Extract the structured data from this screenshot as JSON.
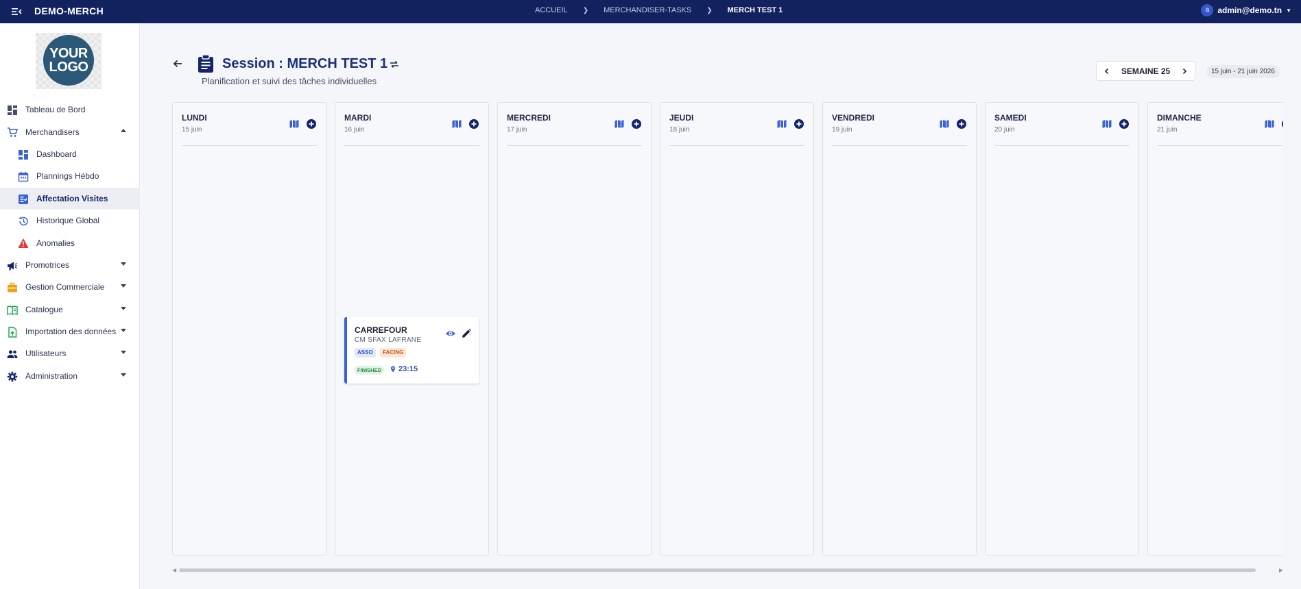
{
  "app": {
    "title": "DEMO-MERCH"
  },
  "breadcrumb": [
    "ACCUEIL",
    "MERCHANDISER-TASKS",
    "MERCH TEST 1"
  ],
  "user": {
    "initial": "a",
    "email": "admin@demo.tn"
  },
  "logo": {
    "line1": "YOUR",
    "line2": "LOGO"
  },
  "sidebar": {
    "items": [
      {
        "label": "Tableau de Bord",
        "icon": "dashboard-icon"
      },
      {
        "label": "Merchandisers",
        "icon": "cart-icon",
        "expanded": true
      },
      {
        "label": "Dashboard",
        "icon": "dashboard-grid-icon"
      },
      {
        "label": "Plannings Hébdo",
        "icon": "calendar-icon"
      },
      {
        "label": "Affectation Visites",
        "icon": "checklist-icon",
        "active": true
      },
      {
        "label": "Historique Global",
        "icon": "history-icon"
      },
      {
        "label": "Anomalies",
        "icon": "warning-icon"
      },
      {
        "label": "Promotrices",
        "icon": "megaphone-icon"
      },
      {
        "label": "Gestion Commerciale",
        "icon": "briefcase-icon"
      },
      {
        "label": "Catalogue",
        "icon": "book-icon"
      },
      {
        "label": "Importation des données",
        "icon": "upload-file-icon"
      },
      {
        "label": "Utilisateurs",
        "icon": "users-icon"
      },
      {
        "label": "Administration",
        "icon": "gear-icon"
      }
    ]
  },
  "header": {
    "title": "Session : MERCH TEST 1",
    "subtitle": "Planification et suivi des tâches individuelles",
    "week_label": "SEMAINE 25",
    "date_range": "15 juin - 21 juin 2026"
  },
  "days": [
    {
      "name": "LUNDI",
      "date": "15 juin"
    },
    {
      "name": "MARDI",
      "date": "16 juin"
    },
    {
      "name": "MERCREDI",
      "date": "17 juin"
    },
    {
      "name": "JEUDI",
      "date": "18 juin"
    },
    {
      "name": "VENDREDI",
      "date": "19 juin"
    },
    {
      "name": "SAMEDI",
      "date": "20 juin"
    },
    {
      "name": "DIMANCHE",
      "date": "21 juin"
    }
  ],
  "task": {
    "store": "CARREFOUR",
    "location": "CM SFAX LAFRANE",
    "tags": [
      "ASSO",
      "FACING"
    ],
    "status": "FINISHED",
    "time": "23:15"
  },
  "colors": {
    "topbar": "#12225e",
    "accent": "#3a62d8",
    "title": "#1a2f7a"
  }
}
